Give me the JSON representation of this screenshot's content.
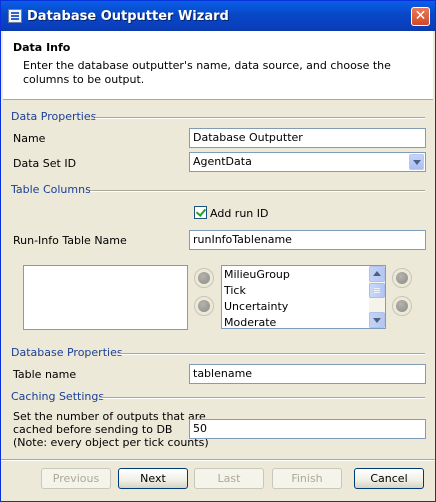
{
  "window": {
    "title": "Database Outputter Wizard",
    "close_glyph": "✕"
  },
  "header": {
    "title": "Data Info",
    "description": "Enter the database outputter's name, data source, and choose the columns to be output."
  },
  "data_properties": {
    "section_label": "Data Properties",
    "name_label": "Name",
    "name_value": "Database Outputter",
    "dataset_label": "Data Set ID",
    "dataset_value": "AgentData"
  },
  "table_columns": {
    "section_label": "Table Columns",
    "add_run_id_label": "Add run ID",
    "add_run_id_checked": true,
    "runinfo_label": "Run-Info Table Name",
    "runinfo_value": "runInfoTablename",
    "left_list": [],
    "right_list": [
      "MilieuGroup",
      "Tick",
      "Uncertainty",
      "Moderate"
    ]
  },
  "database_properties": {
    "section_label": "Database Properties",
    "table_name_label": "Table name",
    "table_name_value": "tablename"
  },
  "caching": {
    "section_label": "Caching Settings",
    "description_line1": "Set the number of outputs that are",
    "description_line2": "cached before sending to DB",
    "description_line3": "(Note: every object per tick counts)",
    "value": "50"
  },
  "buttons": {
    "previous": "Previous",
    "next": "Next",
    "last": "Last",
    "finish": "Finish",
    "cancel": "Cancel"
  }
}
